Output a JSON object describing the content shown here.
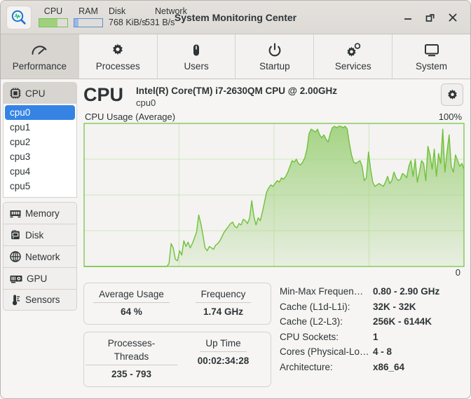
{
  "window": {
    "title": "System Monitoring Center",
    "app_icon": "magnifier-waveform-icon",
    "minimize_label": "—",
    "maximize_label": "❐",
    "close_label": "✕"
  },
  "mini_meters": {
    "cpu_label": "CPU",
    "cpu_percent": 65,
    "cpu_color": "#9fd17c",
    "ram_label": "RAM",
    "ram_percent": 14,
    "ram_color": "#9bb9e4",
    "disk_label": "Disk",
    "disk_value": "768 KiB/s",
    "network_label": "Network",
    "network_value": "531 B/s"
  },
  "tabs": [
    {
      "label": "Performance",
      "icon": "speedometer-icon",
      "active": true
    },
    {
      "label": "Processes",
      "icon": "gear-icon",
      "active": false
    },
    {
      "label": "Users",
      "icon": "mouse-icon",
      "active": false
    },
    {
      "label": "Startup",
      "icon": "power-icon",
      "active": false
    },
    {
      "label": "Services",
      "icon": "gears-icon",
      "active": false
    },
    {
      "label": "System",
      "icon": "monitor-icon",
      "active": false
    }
  ],
  "sidebar": {
    "cpu_button": {
      "label": "CPU",
      "icon": "chip-icon",
      "active": true
    },
    "cpu_list": [
      "cpu0",
      "cpu1",
      "cpu2",
      "cpu3",
      "cpu4",
      "cpu5"
    ],
    "cpu_selected": "cpu0",
    "devices": [
      {
        "label": "Memory",
        "icon": "ram-stick-icon"
      },
      {
        "label": "Disk",
        "icon": "hard-drive-icon"
      },
      {
        "label": "Network",
        "icon": "globe-icon"
      },
      {
        "label": "GPU",
        "icon": "graphics-card-icon"
      },
      {
        "label": "Sensors",
        "icon": "thermometer-icon"
      }
    ]
  },
  "main": {
    "title": "CPU",
    "model": "Intel(R) Core(TM) i7-2630QM CPU @ 2.00GHz",
    "device": "cpu0",
    "settings_icon": "gear-icon",
    "accent_color": "#6fc13a"
  },
  "chart_data": {
    "type": "area",
    "title": "CPU Usage (Average)",
    "ylabel": "",
    "xlabel": "",
    "ymax_label": "100%",
    "ymin_label": "0",
    "ylim": [
      0,
      100
    ],
    "grid": true,
    "h_gridlines": 3,
    "v_gridlines": 3,
    "line_color": "#6fc13a",
    "fill_color": "#9fd17c",
    "values": [
      0,
      0,
      0,
      0,
      0,
      0,
      0,
      0,
      0,
      0,
      0,
      0,
      0,
      0,
      0,
      0,
      0,
      0,
      0,
      0,
      0,
      0,
      0,
      0,
      0,
      0,
      0,
      0,
      0,
      0,
      0,
      0,
      0,
      0,
      0,
      0,
      0,
      0,
      0,
      0,
      2,
      16,
      13,
      5,
      4,
      11,
      8,
      18,
      14,
      17,
      13,
      16,
      20,
      24,
      36,
      30,
      22,
      13,
      11,
      14,
      13,
      12,
      15,
      16,
      18,
      21,
      24,
      26,
      28,
      30,
      31,
      28,
      27,
      30,
      29,
      33,
      32,
      30,
      34,
      46,
      35,
      29,
      34,
      32,
      38,
      45,
      52,
      55,
      57,
      56,
      58,
      60,
      59,
      62,
      61,
      63,
      66,
      70,
      74,
      73,
      75,
      72,
      71,
      73,
      76,
      82,
      93,
      96,
      95,
      94,
      96,
      92,
      90,
      92,
      89,
      87,
      93,
      97,
      98,
      97,
      98,
      98,
      97,
      98,
      96,
      86,
      78,
      73,
      72,
      73,
      74,
      70,
      60,
      62,
      80,
      68,
      59,
      56,
      57,
      58,
      57,
      56,
      59,
      63,
      58,
      60,
      66,
      62,
      60,
      61,
      65,
      64,
      62,
      70,
      74,
      63,
      75,
      59,
      66,
      74,
      72,
      60,
      84,
      78,
      68,
      82,
      63,
      79,
      72,
      96,
      66,
      80,
      92,
      70,
      66,
      78,
      74,
      70,
      72,
      68
    ]
  },
  "cards": [
    {
      "cells": [
        {
          "key": "Average Usage",
          "value": "64 %"
        },
        {
          "key": "Frequency",
          "value": "1.74 GHz"
        }
      ]
    },
    {
      "cells": [
        {
          "key": "Processes-Threads",
          "value": "235 - 793"
        },
        {
          "key": "Up Time",
          "value": "00:02:34:28"
        }
      ]
    }
  ],
  "specs": [
    {
      "key": "Min-Max Frequen…",
      "value": "0.80 - 2.90 GHz"
    },
    {
      "key": "Cache (L1d-L1i):",
      "value": "32K - 32K"
    },
    {
      "key": "Cache (L2-L3):",
      "value": "256K - 6144K"
    },
    {
      "key": "CPU Sockets:",
      "value": "1"
    },
    {
      "key": "Cores (Physical-Lo…",
      "value": "4 - 8"
    },
    {
      "key": "Architecture:",
      "value": "x86_64"
    }
  ]
}
